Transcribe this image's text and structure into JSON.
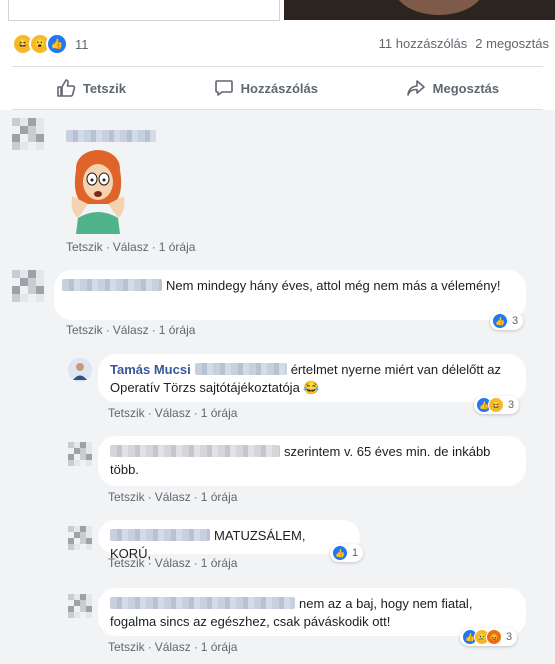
{
  "post": {
    "reaction_count": "11",
    "comments_count": "11 hozzászólás",
    "shares_count": "2 megosztás",
    "reaction_icons": [
      "laugh-icon",
      "wow-icon",
      "like-icon"
    ]
  },
  "actions": {
    "like": "Tetszik",
    "comment": "Hozzászólás",
    "share": "Megosztás"
  },
  "comments": [
    {
      "text": "",
      "has_sticker": true,
      "like": "Tetszik",
      "reply": "Válasz",
      "time": "1 órája"
    },
    {
      "text": "Nem mindegy hány éves, attol még nem más a vélemény!",
      "like": "Tetszik",
      "reply": "Válasz",
      "time": "1 órája",
      "reactions": "3",
      "reaction_icons": [
        "like-icon"
      ],
      "replies": [
        {
          "author": "Tamás Mucsi",
          "text": "értelmet nyerne miért van délelőtt az Operatív Törzs sajtótájékoztatója 😂",
          "like": "Tetszik",
          "reply": "Válasz",
          "time": "1 órája",
          "reactions": "3",
          "reaction_icons": [
            "like-icon",
            "laugh-icon"
          ]
        },
        {
          "author": "",
          "text": "szerintem v. 65 éves min. de inkább több.",
          "like": "Tetszik",
          "reply": "Válasz",
          "time": "1 órája"
        },
        {
          "author": "",
          "text": "MATUZSÁLEM, KORÚ,",
          "like": "Tetszik",
          "reply": "Válasz",
          "time": "1 órája",
          "reactions": "1",
          "reaction_icons": [
            "like-icon"
          ]
        },
        {
          "author": "",
          "text": "nem az a baj, hogy nem fiatal, fogalma sincs az egészhez, csak páváskodik ott!",
          "like": "Tetszik",
          "reply": "Válasz",
          "time": "1 órája",
          "reactions": "3",
          "reaction_icons": [
            "like-icon",
            "sad-icon",
            "angry-icon"
          ]
        }
      ]
    }
  ],
  "colors": {
    "link_blue": "#385898",
    "like_blue": "#2078f4",
    "meta_gray": "#606770",
    "comment_bg": "#f2f3f5"
  }
}
